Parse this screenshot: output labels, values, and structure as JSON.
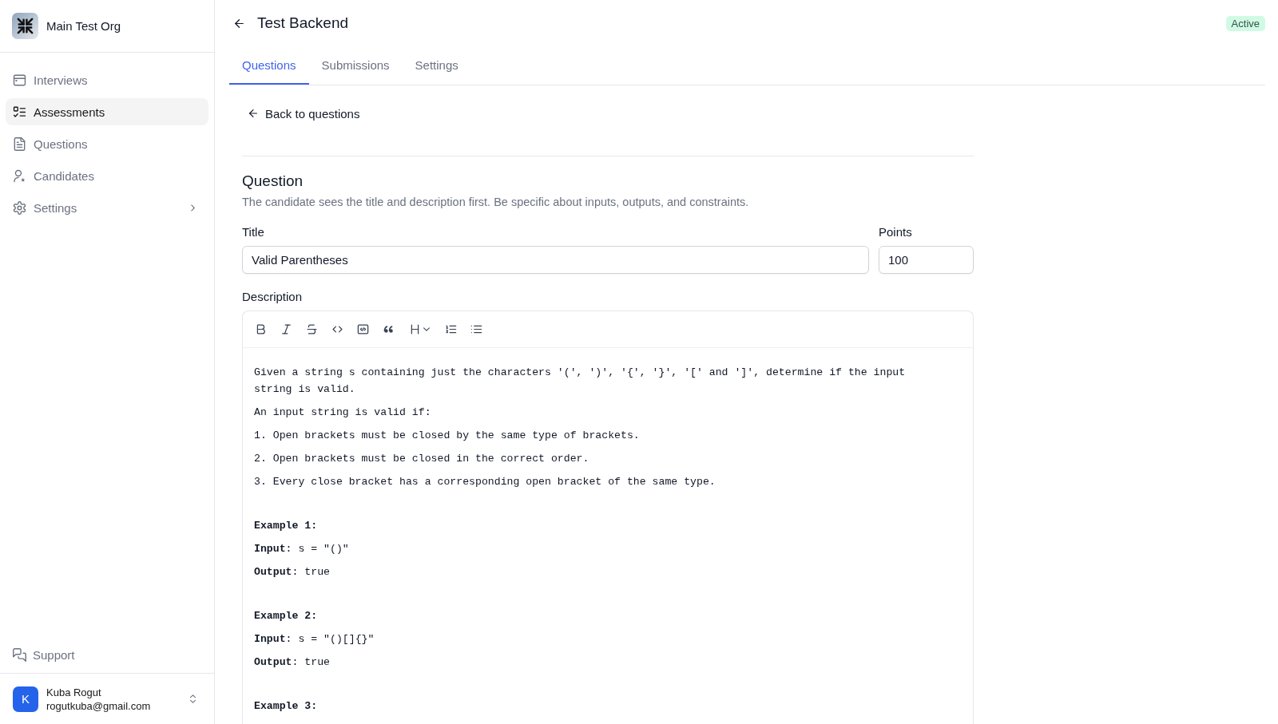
{
  "sidebar": {
    "org_name": "Main Test Org",
    "nav": [
      {
        "label": "Interviews",
        "selected": false,
        "kind": "link"
      },
      {
        "label": "Assessments",
        "selected": true,
        "kind": "link"
      },
      {
        "label": "Questions",
        "selected": false,
        "kind": "link"
      },
      {
        "label": "Candidates",
        "selected": false,
        "kind": "link"
      },
      {
        "label": "Settings",
        "selected": false,
        "kind": "group"
      }
    ],
    "support": "Support",
    "user": {
      "initial": "K",
      "name": "Kuba Rogut",
      "email": "rogutkuba@gmail.com"
    }
  },
  "header": {
    "title": "Test Backend",
    "status": "Active"
  },
  "tabs": [
    {
      "label": "Questions",
      "selected": true
    },
    {
      "label": "Submissions",
      "selected": false
    },
    {
      "label": "Settings",
      "selected": false
    }
  ],
  "back_link": "Back to questions",
  "question": {
    "heading": "Question",
    "hint": "The candidate sees the title and description first. Be specific about inputs, outputs, and constraints.",
    "title_field": {
      "label": "Title",
      "value": "Valid Parentheses"
    },
    "points_field": {
      "label": "Points",
      "value": "100"
    },
    "description": {
      "label": "Description",
      "sections": [
        [
          {
            "kind": "text",
            "text": "Given a string s containing just the characters '(', ')', '{', '}', '[' and ']', determine if the input string is valid."
          },
          {
            "kind": "text",
            "text": "An input string is valid if:"
          },
          {
            "kind": "text",
            "text": "1. Open brackets must be closed by the same type of brackets."
          },
          {
            "kind": "text",
            "text": "2. Open brackets must be closed in the correct order."
          },
          {
            "kind": "text",
            "text": "3. Every close bracket has a corresponding open bracket of the same type."
          }
        ],
        [
          {
            "kind": "heading",
            "text": "Example 1:"
          },
          {
            "kind": "text",
            "text": "**Input**: s = \"()\""
          },
          {
            "kind": "text",
            "text": "**Output**: true"
          }
        ],
        [
          {
            "kind": "heading",
            "text": "Example 2:"
          },
          {
            "kind": "text",
            "text": "**Input**: s = \"()[]{}\""
          },
          {
            "kind": "text",
            "text": "**Output**: true"
          }
        ],
        [
          {
            "kind": "heading",
            "text": "Example 3:"
          }
        ]
      ]
    }
  }
}
